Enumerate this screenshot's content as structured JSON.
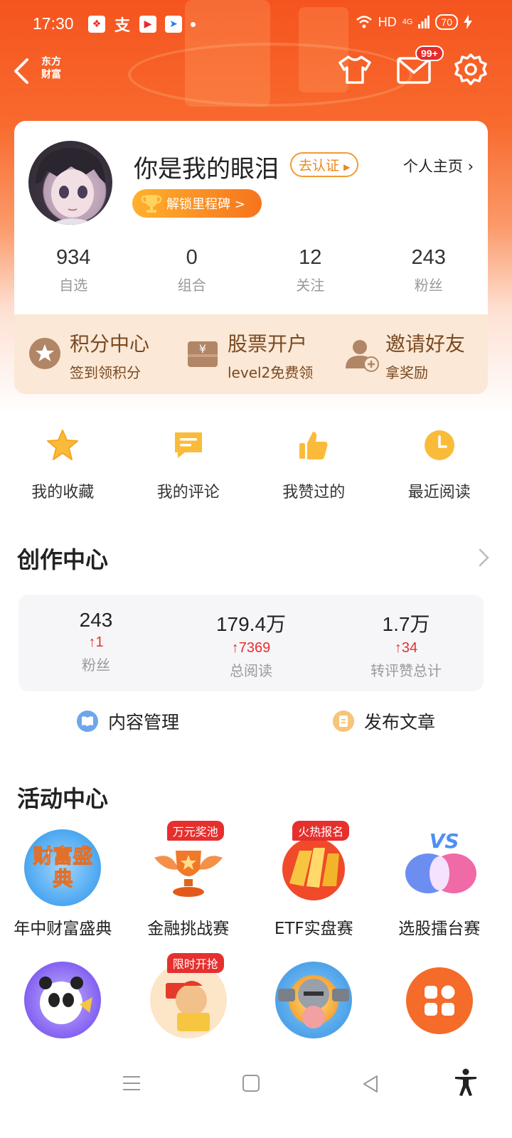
{
  "status": {
    "time": "17:30",
    "network": "HD",
    "signal": "4G",
    "battery": "70"
  },
  "topbar": {
    "brand_line1": "东方",
    "brand_line2": "财富",
    "mail_badge": "99+"
  },
  "profile": {
    "username": "你是我的眼泪",
    "verify_label": "去认证",
    "homepage_label": "个人主页 ›",
    "milestone_label": "解锁里程碑 >",
    "stats": [
      {
        "value": "934",
        "label": "自选"
      },
      {
        "value": "0",
        "label": "组合"
      },
      {
        "value": "12",
        "label": "关注"
      },
      {
        "value": "243",
        "label": "粉丝"
      }
    ]
  },
  "quick": [
    {
      "title": "积分中心",
      "sub": "签到领积分",
      "icon": "star-medal-icon"
    },
    {
      "title": "股票开户",
      "sub": "level2免费领",
      "icon": "yuan-box-icon"
    },
    {
      "title": "邀请好友",
      "sub": "拿奖励",
      "icon": "add-user-icon"
    }
  ],
  "shortcuts": [
    {
      "label": "我的收藏",
      "icon": "star-icon"
    },
    {
      "label": "我的评论",
      "icon": "comment-icon"
    },
    {
      "label": "我赞过的",
      "icon": "thumbs-up-icon"
    },
    {
      "label": "最近阅读",
      "icon": "clock-icon"
    }
  ],
  "creation": {
    "title": "创作中心",
    "stats": [
      {
        "value": "243",
        "delta": "1",
        "label": "粉丝"
      },
      {
        "value": "179.4万",
        "delta": "7369",
        "label": "总阅读"
      },
      {
        "value": "1.7万",
        "delta": "34",
        "label": "转评赞总计"
      }
    ],
    "manage_label": "内容管理",
    "publish_label": "发布文章"
  },
  "activity": {
    "title": "活动中心",
    "row1": [
      {
        "label": "年中财富盛典",
        "tag": ""
      },
      {
        "label": "金融挑战赛",
        "tag": "万元奖池"
      },
      {
        "label": "ETF实盘赛",
        "tag": "火热报名"
      },
      {
        "label": "选股擂台赛",
        "tag": ""
      }
    ],
    "row2": [
      {
        "label": "",
        "tag": ""
      },
      {
        "label": "",
        "tag": "限时开抢"
      },
      {
        "label": "",
        "tag": ""
      },
      {
        "label": "",
        "tag": ""
      }
    ],
    "banner_text": "财富盛典",
    "vs_text": "VS"
  },
  "colors": {
    "brand_orange": "#f5541f",
    "accent_red": "#e5302e",
    "quick_bg": "#fbe8d6"
  }
}
